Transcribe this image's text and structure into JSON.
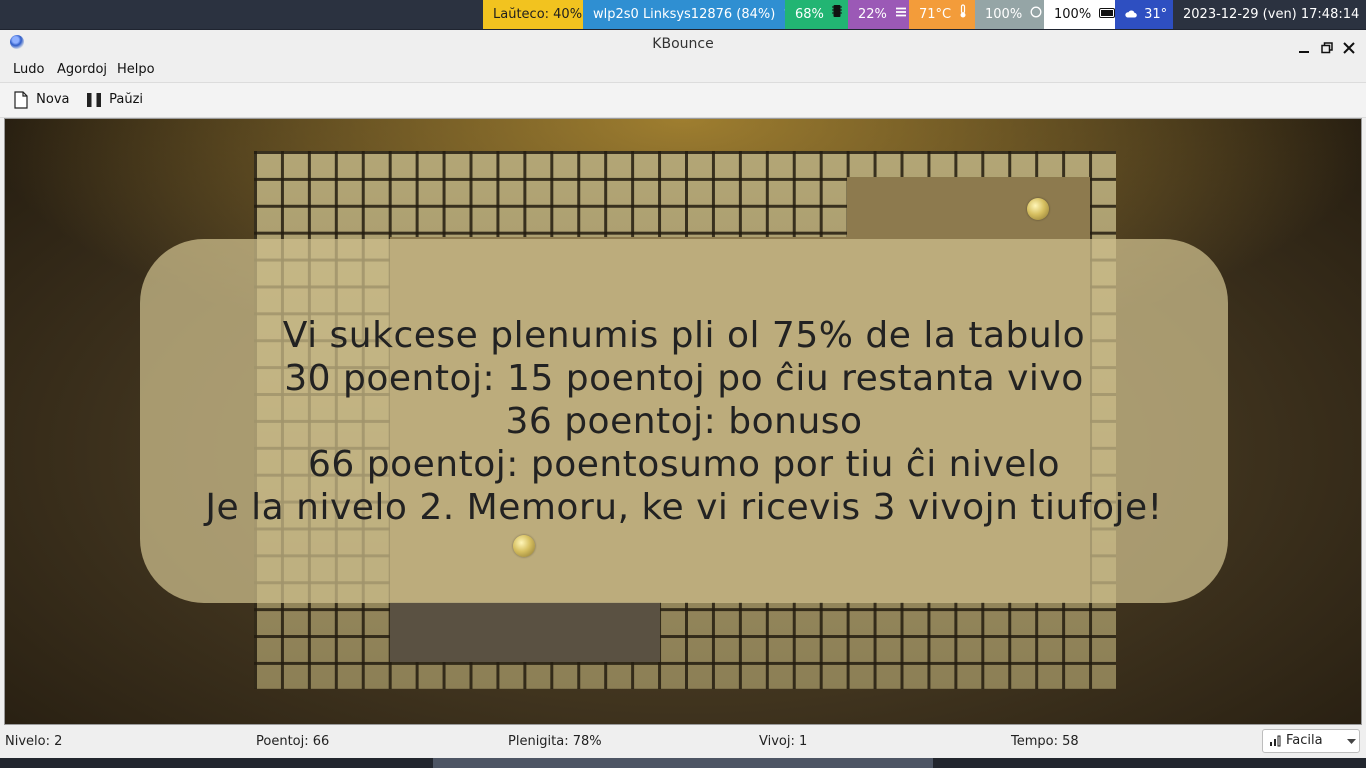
{
  "system_bar": {
    "items": [
      {
        "text": "Laŭteco: 40%",
        "bg": "#f2c31f",
        "fg": "#1f1f1f"
      },
      {
        "text": "wlp2s0 Linksys12876 (84%)",
        "bg": "#2f8fd2",
        "fg": "#ffffff",
        "icon": "wifi-icon"
      },
      {
        "text": "68%",
        "bg": "#22b573",
        "fg": "#ffffff",
        "icon": "cpu-icon"
      },
      {
        "text": "22%",
        "bg": "#9b59b6",
        "fg": "#ffffff",
        "icon": "memory-icon"
      },
      {
        "text": "71°C",
        "bg": "#f39c3a",
        "fg": "#ffffff",
        "icon": "thermometer-icon"
      },
      {
        "text": "100%",
        "bg": "#95a5a6",
        "fg": "#ffffff",
        "icon": "brightness-icon"
      },
      {
        "text": "100%",
        "bg": "#ffffff",
        "fg": "#111111",
        "icon": "battery-icon"
      },
      {
        "text": "31°",
        "bg": "#2e4fc1",
        "fg": "#ffffff",
        "icon": "weather-cloud-icon"
      },
      {
        "text": "2023-12-29 (ven) 17:48:14",
        "bg": "#2b3240",
        "fg": "#ffffff",
        "icon": "clock-icon"
      }
    ]
  },
  "window": {
    "title": "KBounce",
    "menu": [
      "Ludo",
      "Agordoj",
      "Helpo"
    ],
    "toolbar": {
      "new_label": "Nova",
      "pause_label": "Paŭzi"
    }
  },
  "game": {
    "message_lines": [
      "Vi sukcese plenumis pli ol 75% de la tabulo",
      "30 poentoj: 15 poentoj po ĉiu restanta vivo",
      "36 poentoj: bonuso",
      "66 poentoj: poentosumo por tiu ĉi nivelo",
      "Je la nivelo 2. Memoru, ke vi ricevis 3 vivojn tiufoje!"
    ],
    "ball_count": 2
  },
  "status": {
    "level": "Nivelo: 2",
    "score": "Poentoj: 66",
    "filled": "Plenigita: 78%",
    "lives": "Vivoj: 1",
    "time": "Tempo: 58",
    "difficulty": "Facila"
  }
}
